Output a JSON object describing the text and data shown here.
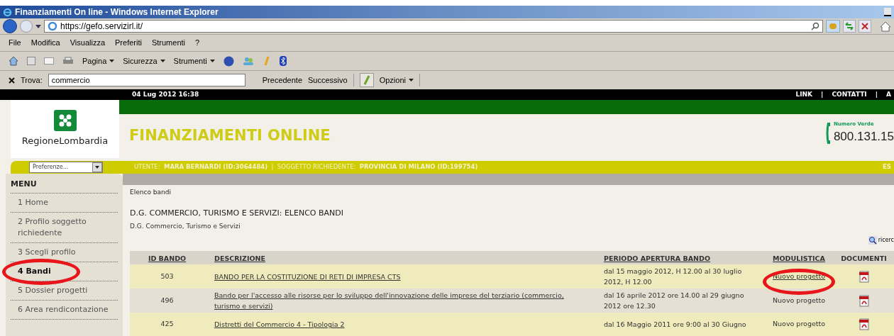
{
  "browser": {
    "title": "Finanziamenti On line - Windows Internet Explorer",
    "address": "https://gefo.servizirl.it/",
    "menu": [
      "File",
      "Modifica",
      "Visualizza",
      "Preferiti",
      "Strumenti",
      "?"
    ],
    "commands": [
      "Pagina",
      "Sicurezza",
      "Strumenti"
    ],
    "find": {
      "label": "Trova:",
      "value": "commercio",
      "buttons": [
        "Precedente",
        "Successivo"
      ],
      "options": "Opzioni"
    }
  },
  "page": {
    "date": "04 Lug 2012 16:38",
    "top_links": [
      "LINK",
      "|",
      "CONTATTI",
      "|",
      "A"
    ],
    "logo_text": "RegioneLombardia",
    "header_title": "FINANZIAMENTI ONLINE",
    "hotline_label": "Numero Verde",
    "hotline": "800.131.15",
    "preferences": "Preferenze...",
    "user_bar": "UTENTE:  **MARA BERNARDI (ID:3064484)**  |  SOGGETTO RICHIEDENTE:  **PROVINCIA DI MILANO (ID:199754)**",
    "logout": "ES"
  },
  "sidebar": {
    "title": "MENU",
    "items": [
      {
        "label": "1  Home",
        "selected": false,
        "circled": false
      },
      {
        "label": "2  Profilo soggetto richiedente",
        "selected": false,
        "circled": false
      },
      {
        "label": "3  Scegli profilo",
        "selected": false,
        "circled": false
      },
      {
        "label": "4  Bandi",
        "selected": true,
        "circled": true
      },
      {
        "label": "5  Dossier progetti",
        "selected": false,
        "circled": false
      },
      {
        "label": "6  Area rendicontazione",
        "selected": false,
        "circled": false
      }
    ]
  },
  "content": {
    "breadcrumb": "Elenco bandi",
    "heading": "D.G. COMMERCIO, TURISMO E SERVIZI: ELENCO BANDI",
    "subheading": "D.G. Commercio, Turismo e Servizi",
    "search_link": "ricerc",
    "columns": [
      "ID BANDO",
      "DESCRIZIONE",
      "PERIODO APERTURA BANDO",
      "MODULISTICA",
      "DOCUMENTI"
    ],
    "rows": [
      {
        "id": "503",
        "description": "BANDO PER LA COSTITUZIONE DI RETI DI IMPRESA CTS",
        "period": "dal 15 maggio 2012, H 12.00 al 30 luglio 2012, H 12.00",
        "form": "Nuovo progetto",
        "form_link": true,
        "circled": true
      },
      {
        "id": "496",
        "description": "Bando per l'accesso alle risorse per lo sviluppo dell'innovazione delle imprese del terziario (commercio, turismo e servizi)",
        "period": "dal 16 aprile 2012 ore 14.00 al 29 giugno 2012 ore 12.30",
        "form": "Nuovo progetto",
        "form_link": false,
        "circled": false
      },
      {
        "id": "425",
        "description": "Distretti del Commercio 4 - Tipologia 2",
        "period": "dal 16 Maggio 2011 ore 9:00 al 30 Giugno",
        "form": "Nuovo progetto",
        "form_link": false,
        "circled": false
      }
    ]
  }
}
